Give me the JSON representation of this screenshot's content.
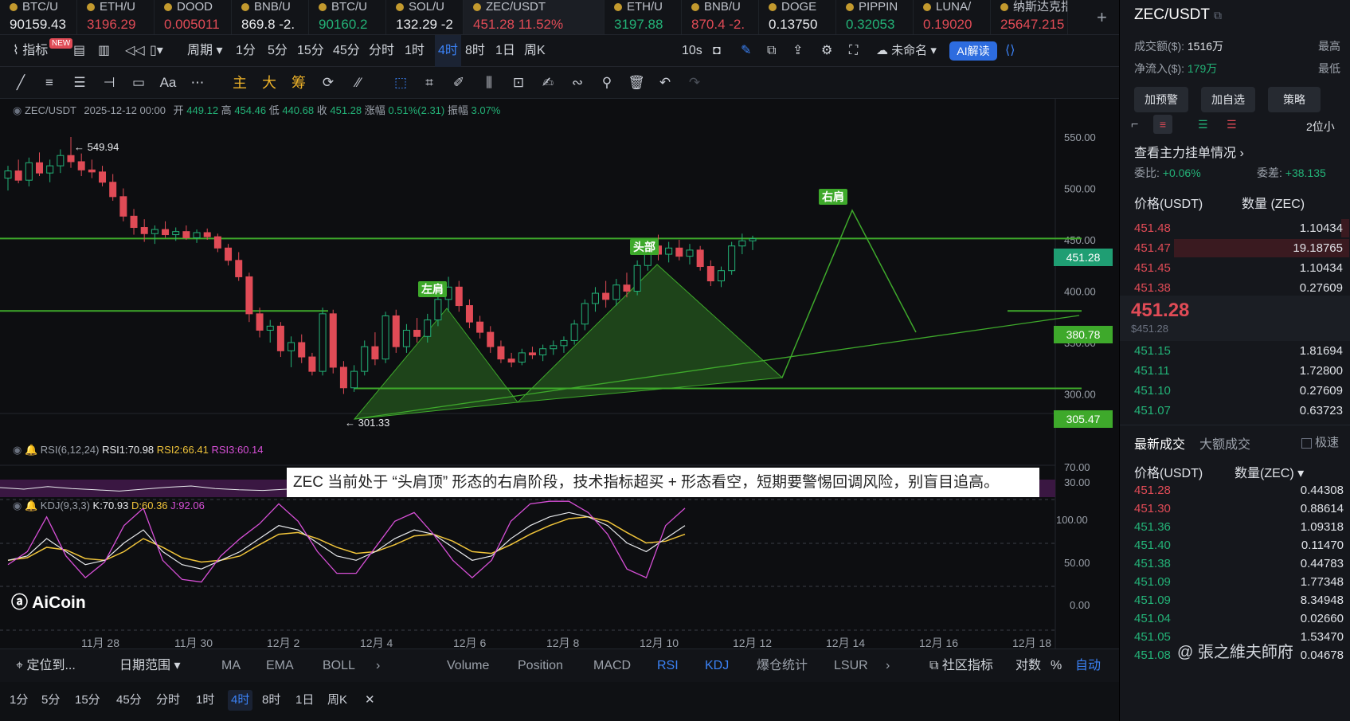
{
  "tickers": [
    {
      "name": "BTC/U",
      "value": "90159.43",
      "cls": "wht"
    },
    {
      "name": "ETH/U",
      "value": "3196.29",
      "cls": "red"
    },
    {
      "name": "DOOD",
      "value": "0.005011",
      "cls": "red"
    },
    {
      "name": "BNB/U",
      "value": "869.8 -2.",
      "cls": "wht"
    },
    {
      "name": "BTC/U",
      "value": "90160.2",
      "cls": "grn"
    },
    {
      "name": "SOL/U",
      "value": "132.29 -2",
      "cls": "wht"
    },
    {
      "name": "ZEC/USDT",
      "value": "451.28 11.52%",
      "cls": "red"
    },
    {
      "name": "ETH/U",
      "value": "3197.88",
      "cls": "grn"
    },
    {
      "name": "BNB/U",
      "value": "870.4 -2.",
      "cls": "red"
    },
    {
      "name": "DOGE",
      "value": "0.13750",
      "cls": "wht"
    },
    {
      "name": "PIPPIN",
      "value": "0.32053",
      "cls": "grn"
    },
    {
      "name": "LUNA/",
      "value": "0.19020",
      "cls": "red"
    },
    {
      "name": "纳斯达克指",
      "value": "25647.215",
      "cls": "red"
    }
  ],
  "toolbar": {
    "indicator": "指标",
    "new_badge": "NEW",
    "period": "周期",
    "intervals": [
      "1分",
      "5分",
      "15分",
      "45分",
      "分时",
      "1时",
      "4时",
      "8时",
      "1日",
      "周K"
    ],
    "active_interval": "4时",
    "refresh": "10s",
    "layout_name": "未命名",
    "ai": "AI解读"
  },
  "toolbar2": {
    "zhu": "主",
    "da": "大",
    "chou": "筹"
  },
  "info": {
    "pair": "ZEC/USDT",
    "time": "2025-12-12 00:00",
    "open_l": "开",
    "open": "449.12",
    "high_l": "高",
    "high": "454.46",
    "low_l": "低",
    "low": "440.68",
    "close_l": "收",
    "close": "451.28",
    "chg_l": "涨幅",
    "chg": "0.51%(2.31)",
    "amp_l": "振幅",
    "amp": "3.07%"
  },
  "chart_data": {
    "type": "candlestick",
    "y_ticks": [
      "550.00",
      "500.00",
      "450.00",
      "400.00",
      "350.00",
      "300.00"
    ],
    "x_ticks": [
      "11月 28",
      "11月 30",
      "12月 2",
      "12月 4",
      "12月 6",
      "12月 8",
      "12月 10",
      "12月 12",
      "12月 14",
      "12月 16",
      "12月 18"
    ],
    "price_labels": [
      {
        "text": "451.28",
        "color": "#1f9e73"
      },
      {
        "text": "380.78",
        "color": "#3ea92b"
      },
      {
        "text": "305.47",
        "color": "#3ea92b"
      }
    ],
    "high_mark": "549.94",
    "low_mark": "301.33",
    "pattern": {
      "left": "左肩",
      "head": "头部",
      "right": "右肩"
    },
    "candles": [
      {
        "o": 510,
        "h": 522,
        "l": 498,
        "c": 517
      },
      {
        "o": 517,
        "h": 528,
        "l": 505,
        "c": 508
      },
      {
        "o": 508,
        "h": 530,
        "l": 502,
        "c": 525
      },
      {
        "o": 525,
        "h": 535,
        "l": 512,
        "c": 515
      },
      {
        "o": 515,
        "h": 528,
        "l": 506,
        "c": 522
      },
      {
        "o": 522,
        "h": 538,
        "l": 515,
        "c": 532
      },
      {
        "o": 532,
        "h": 550,
        "l": 520,
        "c": 526
      },
      {
        "o": 526,
        "h": 534,
        "l": 512,
        "c": 518
      },
      {
        "o": 518,
        "h": 528,
        "l": 510,
        "c": 516
      },
      {
        "o": 516,
        "h": 522,
        "l": 502,
        "c": 506
      },
      {
        "o": 506,
        "h": 514,
        "l": 488,
        "c": 492
      },
      {
        "o": 492,
        "h": 500,
        "l": 468,
        "c": 473
      },
      {
        "o": 473,
        "h": 480,
        "l": 455,
        "c": 462
      },
      {
        "o": 462,
        "h": 470,
        "l": 448,
        "c": 456
      },
      {
        "o": 456,
        "h": 464,
        "l": 446,
        "c": 460
      },
      {
        "o": 460,
        "h": 468,
        "l": 452,
        "c": 455
      },
      {
        "o": 455,
        "h": 462,
        "l": 449,
        "c": 458
      },
      {
        "o": 458,
        "h": 464,
        "l": 450,
        "c": 452
      },
      {
        "o": 452,
        "h": 460,
        "l": 447,
        "c": 457
      },
      {
        "o": 457,
        "h": 461,
        "l": 450,
        "c": 453
      },
      {
        "o": 453,
        "h": 456,
        "l": 438,
        "c": 442
      },
      {
        "o": 442,
        "h": 446,
        "l": 425,
        "c": 430
      },
      {
        "o": 430,
        "h": 438,
        "l": 410,
        "c": 414
      },
      {
        "o": 414,
        "h": 418,
        "l": 370,
        "c": 378
      },
      {
        "o": 378,
        "h": 384,
        "l": 355,
        "c": 362
      },
      {
        "o": 362,
        "h": 372,
        "l": 350,
        "c": 366
      },
      {
        "o": 366,
        "h": 370,
        "l": 336,
        "c": 342
      },
      {
        "o": 342,
        "h": 356,
        "l": 326,
        "c": 350
      },
      {
        "o": 350,
        "h": 358,
        "l": 330,
        "c": 336
      },
      {
        "o": 336,
        "h": 340,
        "l": 318,
        "c": 322
      },
      {
        "o": 322,
        "h": 384,
        "l": 318,
        "c": 378
      },
      {
        "o": 378,
        "h": 382,
        "l": 320,
        "c": 326
      },
      {
        "o": 326,
        "h": 332,
        "l": 300,
        "c": 306
      },
      {
        "o": 306,
        "h": 328,
        "l": 302,
        "c": 322
      },
      {
        "o": 322,
        "h": 352,
        "l": 318,
        "c": 346
      },
      {
        "o": 346,
        "h": 360,
        "l": 328,
        "c": 334
      },
      {
        "o": 334,
        "h": 380,
        "l": 330,
        "c": 376
      },
      {
        "o": 376,
        "h": 382,
        "l": 340,
        "c": 346
      },
      {
        "o": 346,
        "h": 368,
        "l": 340,
        "c": 362
      },
      {
        "o": 362,
        "h": 374,
        "l": 350,
        "c": 356
      },
      {
        "o": 356,
        "h": 378,
        "l": 350,
        "c": 372
      },
      {
        "o": 372,
        "h": 398,
        "l": 366,
        "c": 392
      },
      {
        "o": 392,
        "h": 414,
        "l": 380,
        "c": 404
      },
      {
        "o": 404,
        "h": 410,
        "l": 380,
        "c": 386
      },
      {
        "o": 386,
        "h": 392,
        "l": 364,
        "c": 370
      },
      {
        "o": 370,
        "h": 376,
        "l": 354,
        "c": 360
      },
      {
        "o": 360,
        "h": 366,
        "l": 340,
        "c": 346
      },
      {
        "o": 346,
        "h": 352,
        "l": 330,
        "c": 334
      },
      {
        "o": 334,
        "h": 340,
        "l": 326,
        "c": 331
      },
      {
        "o": 331,
        "h": 344,
        "l": 328,
        "c": 340
      },
      {
        "o": 340,
        "h": 346,
        "l": 334,
        "c": 338
      },
      {
        "o": 338,
        "h": 348,
        "l": 332,
        "c": 344
      },
      {
        "o": 344,
        "h": 352,
        "l": 338,
        "c": 347
      },
      {
        "o": 347,
        "h": 356,
        "l": 340,
        "c": 352
      },
      {
        "o": 352,
        "h": 372,
        "l": 348,
        "c": 368
      },
      {
        "o": 368,
        "h": 392,
        "l": 362,
        "c": 388
      },
      {
        "o": 388,
        "h": 404,
        "l": 380,
        "c": 398
      },
      {
        "o": 398,
        "h": 410,
        "l": 384,
        "c": 392
      },
      {
        "o": 392,
        "h": 412,
        "l": 386,
        "c": 406
      },
      {
        "o": 406,
        "h": 418,
        "l": 394,
        "c": 400
      },
      {
        "o": 400,
        "h": 430,
        "l": 396,
        "c": 425
      },
      {
        "o": 425,
        "h": 450,
        "l": 420,
        "c": 444
      },
      {
        "o": 444,
        "h": 455,
        "l": 430,
        "c": 436
      },
      {
        "o": 436,
        "h": 448,
        "l": 428,
        "c": 442
      },
      {
        "o": 442,
        "h": 450,
        "l": 430,
        "c": 434
      },
      {
        "o": 434,
        "h": 446,
        "l": 426,
        "c": 440
      },
      {
        "o": 440,
        "h": 444,
        "l": 420,
        "c": 424
      },
      {
        "o": 424,
        "h": 430,
        "l": 405,
        "c": 410
      },
      {
        "o": 410,
        "h": 424,
        "l": 404,
        "c": 420
      },
      {
        "o": 420,
        "h": 448,
        "l": 416,
        "c": 444
      },
      {
        "o": 444,
        "h": 456,
        "l": 436,
        "c": 449
      },
      {
        "o": 449,
        "h": 454,
        "l": 440,
        "c": 451
      }
    ]
  },
  "rsi": {
    "label": "RSI(6,12,24)",
    "rsi1": "RSI1:70.98",
    "rsi2": "RSI2:66.41",
    "rsi3": "RSI3:60.14",
    "t70": "70.00",
    "t30": "30.00"
  },
  "kdj": {
    "label": "KDJ(9,3,3)",
    "k": "K:70.93",
    "d": "D:60.36",
    "j": "J:92.06",
    "t100": "100.00",
    "t50": "50.00",
    "t0": "0.00"
  },
  "annotation": "ZEC 当前处于 “头肩顶” 形态的右肩阶段，技术指标超买 + 形态看空，短期要警惕回调风险，别盲目追高。",
  "logo": "AiCoin",
  "bottom": {
    "locate": "定位到...",
    "range": "日期范围",
    "inds": [
      "MA",
      "EMA",
      "BOLL"
    ],
    "subs": [
      "Volume",
      "Position",
      "MACD",
      "RSI",
      "KDJ",
      "爆仓统计",
      "LSUR"
    ],
    "community": "社区指标",
    "log": "对数",
    "pct": "%",
    "auto": "自动"
  },
  "bottom2": [
    "1分",
    "5分",
    "15分",
    "45分",
    "分时",
    "1时",
    "4时",
    "8时",
    "1日",
    "周K"
  ],
  "right": {
    "pair": "ZEC/USDT",
    "turnover_l": "成交额($):",
    "turnover": "1516万",
    "inflow_l": "净流入($):",
    "inflow": "179万",
    "hi_l": "最高",
    "lo_l": "最低",
    "btns": [
      "加预警",
      "加自选",
      "策略"
    ],
    "depth": "2位小",
    "mainorders": "查看主力挂单情况",
    "weibi_l": "委比:",
    "weibi": "+0.06%",
    "weicha_l": "委差:",
    "weicha": "+38.135",
    "col_price": "价格(USDT)",
    "col_qty": "数量 (ZEC)",
    "asks": [
      {
        "p": "451.48",
        "q": "1.10434"
      },
      {
        "p": "451.47",
        "q": "19.18765"
      },
      {
        "p": "451.45",
        "q": "1.10434"
      },
      {
        "p": "451.38",
        "q": "0.27609"
      }
    ],
    "last": "451.28",
    "last_usd": "$451.28",
    "bids": [
      {
        "p": "451.15",
        "q": "1.81694"
      },
      {
        "p": "451.11",
        "q": "1.72800"
      },
      {
        "p": "451.10",
        "q": "0.27609"
      },
      {
        "p": "451.07",
        "q": "0.63723"
      }
    ],
    "tab1": "最新成交",
    "tab2": "大额成交",
    "tab3": "极速",
    "tcol_price": "价格(USDT)",
    "tcol_qty": "数量(ZEC)",
    "trades": [
      {
        "p": "451.28",
        "q": "0.44308",
        "c": "red"
      },
      {
        "p": "451.30",
        "q": "0.88614",
        "c": "red"
      },
      {
        "p": "451.36",
        "q": "1.09318",
        "c": "grn"
      },
      {
        "p": "451.40",
        "q": "0.11470",
        "c": "grn"
      },
      {
        "p": "451.38",
        "q": "0.44783",
        "c": "grn"
      },
      {
        "p": "451.09",
        "q": "1.77348",
        "c": "grn"
      },
      {
        "p": "451.09",
        "q": "8.34948",
        "c": "grn"
      },
      {
        "p": "451.04",
        "q": "0.02660",
        "c": "grn"
      },
      {
        "p": "451.05",
        "q": "1.53470",
        "c": "grn"
      },
      {
        "p": "451.08",
        "q": "0.04678",
        "c": "grn"
      }
    ],
    "watermark": "@ 張之維夫師府"
  }
}
